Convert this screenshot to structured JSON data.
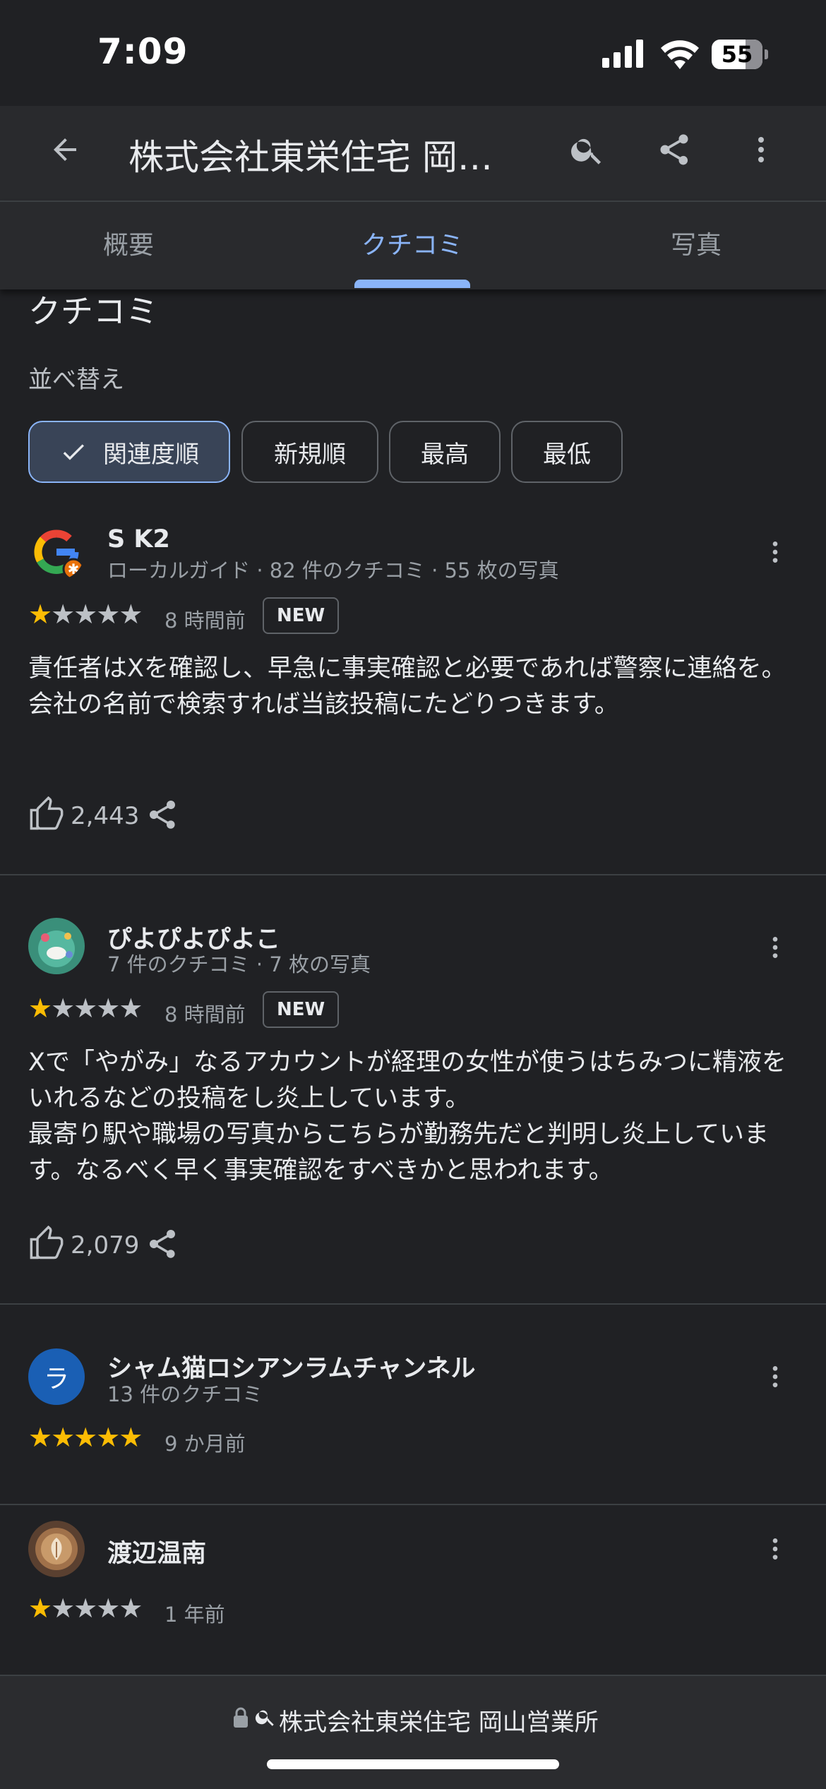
{
  "status_bar": {
    "time": "7:09",
    "battery": "55"
  },
  "app_bar": {
    "title": "株式会社東栄住宅 岡山営業所",
    "back_icon": "arrow-left-icon",
    "search_icon": "search-icon",
    "share_icon": "share-icon",
    "menu_icon": "more-vert-icon"
  },
  "tabs": [
    {
      "label": "概要",
      "active": false
    },
    {
      "label": "クチコミ",
      "active": true
    },
    {
      "label": "写真",
      "active": false
    }
  ],
  "section": {
    "title": "クチコミ",
    "sort_label": "並べ替え"
  },
  "sort_chips": [
    {
      "label": "関連度順",
      "selected": true
    },
    {
      "label": "新規順",
      "selected": false
    },
    {
      "label": "最高",
      "selected": false
    },
    {
      "label": "最低",
      "selected": false
    }
  ],
  "reviews": [
    {
      "name": "S K2",
      "meta": "ローカルガイド · 82 件のクチコミ · 55 枚の写真",
      "rating": 1,
      "time": "8 時間前",
      "badge": "NEW",
      "text": "責任者はXを確認し、早急に事実確認と必要であれば警察に連絡を。\n会社の名前で検索すれば当該投稿にたどりつきます。",
      "likes": "2,443",
      "avatar": "google-logo"
    },
    {
      "name": "ぴよぴよぴよこ",
      "meta": "7 件のクチコミ · 7 枚の写真",
      "rating": 1,
      "time": "8 時間前",
      "badge": "NEW",
      "text": "Xで「やがみ」なるアカウントが経理の女性が使うはちみつに精液をいれるなどの投稿をし炎上しています。\n最寄り駅や職場の写真からこちらが勤務先だと判明し炎上しています。なるべく早く事実確認をすべきかと思われます。",
      "likes": "2,079",
      "avatar": "photo"
    },
    {
      "name": "シャム猫ロシアンラムチャンネル",
      "meta": "13 件のクチコミ",
      "rating": 5,
      "time": "9 か月前",
      "avatar_letter": "ラ",
      "avatar_color": "#1a5fb4"
    },
    {
      "name": "渡辺温南",
      "rating": 1,
      "time": "1 年前",
      "avatar": "coffee-photo"
    }
  ],
  "url_bar": {
    "text": "株式会社東栄住宅 岡山営業所"
  },
  "colors": {
    "accent": "#8ab4f8",
    "star": "#fbbc04",
    "background": "#202124"
  }
}
